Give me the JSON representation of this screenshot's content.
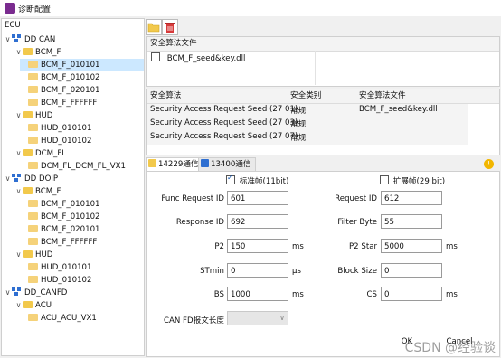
{
  "window": {
    "title": "诊断配置"
  },
  "tree": {
    "header": "ECU",
    "nodes": [
      {
        "label": "DD CAN"
      },
      {
        "label": "BCM_F"
      },
      {
        "label": "BCM_F_010101"
      },
      {
        "label": "BCM_F_010102"
      },
      {
        "label": "BCM_F_020101"
      },
      {
        "label": "BCM_F_FFFFFF"
      },
      {
        "label": "HUD"
      },
      {
        "label": "HUD_010101"
      },
      {
        "label": "HUD_010102"
      },
      {
        "label": "DCM_FL"
      },
      {
        "label": "DCM_FL_DCM_FL_VX1"
      },
      {
        "label": "DD DOIP"
      },
      {
        "label": "BCM_F"
      },
      {
        "label": "BCM_F_010101"
      },
      {
        "label": "BCM_F_010102"
      },
      {
        "label": "BCM_F_020101"
      },
      {
        "label": "BCM_F_FFFFFF"
      },
      {
        "label": "HUD"
      },
      {
        "label": "HUD_010101"
      },
      {
        "label": "HUD_010102"
      },
      {
        "label": "DD_CANFD"
      },
      {
        "label": "ACU"
      },
      {
        "label": "ACU_ACU_VX1"
      }
    ]
  },
  "toolbar": {
    "open_icon": "folder-open-icon",
    "delete_icon": "delete-icon"
  },
  "algo_files": {
    "header": "安全算法文件",
    "items": [
      {
        "name": "BCM_F_seed&key.dll",
        "checked": false
      }
    ]
  },
  "algo_table": {
    "columns": [
      "安全算法",
      "安全类别",
      "安全算法文件"
    ],
    "rows": [
      [
        "Security Access Request Seed (27 01)",
        "常规",
        "BCM_F_seed&key.dll"
      ],
      [
        "Security Access Request Seed (27 03)",
        "常规",
        ""
      ],
      [
        "Security Access Request Seed (27 07)",
        "常规",
        ""
      ]
    ]
  },
  "tabs": [
    {
      "label": "14229通信"
    },
    {
      "label": "13400通信"
    }
  ],
  "form": {
    "standard_frame_label": "标准帧(11bit)",
    "extended_frame_label": "扩展帧(29 bit)",
    "func_request_id": {
      "label": "Func Request ID",
      "value": "601"
    },
    "request_id": {
      "label": "Request ID",
      "value": "612"
    },
    "response_id": {
      "label": "Response ID",
      "value": "692"
    },
    "filter_byte": {
      "label": "Filter Byte",
      "value": "55"
    },
    "p2": {
      "label": "P2",
      "value": "150",
      "unit": "ms"
    },
    "p2_star": {
      "label": "P2 Star",
      "value": "5000",
      "unit": "ms"
    },
    "stmin": {
      "label": "STmin",
      "value": "0",
      "unit": "μs"
    },
    "block_size": {
      "label": "Block Size",
      "value": "0"
    },
    "bs": {
      "label": "BS",
      "value": "1000",
      "unit": "ms"
    },
    "cs": {
      "label": "CS",
      "value": "0",
      "unit": "ms"
    },
    "canfd_len": {
      "label": "CAN FD报文长度",
      "value": ""
    }
  },
  "footer": {
    "ok_label": "OK",
    "cancel_label": "Cancel"
  },
  "watermark": "CSDN @经验谈"
}
